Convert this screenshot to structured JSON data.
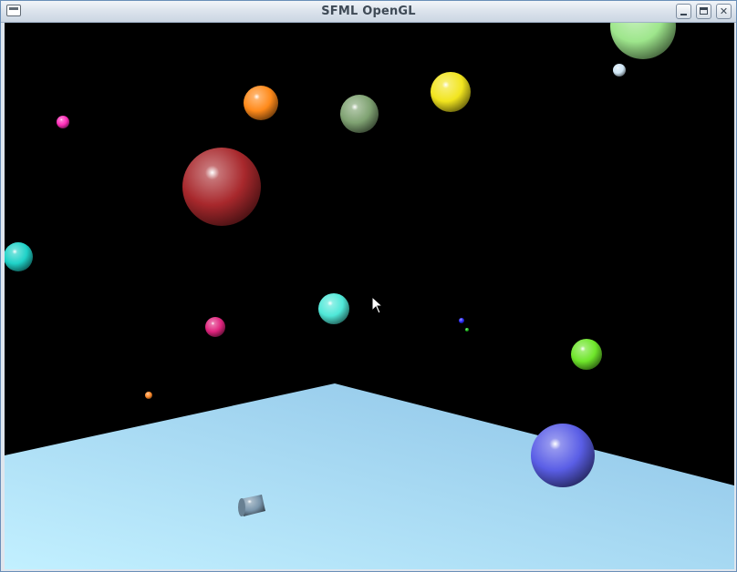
{
  "window": {
    "title": "SFML OpenGL",
    "controls": [
      "minimize",
      "maximize",
      "close"
    ]
  },
  "scene": {
    "background": "#000000",
    "floor": {
      "color_near": "#c2f0ff",
      "color_far": "#8cc2e6"
    },
    "objects": [
      {
        "kind": "sphere",
        "color": "#9ee68c"
      },
      {
        "kind": "sphere",
        "color": "#cfe6f5"
      },
      {
        "kind": "sphere",
        "color": "#ff2db8"
      },
      {
        "kind": "sphere",
        "color": "#ff8a1a"
      },
      {
        "kind": "sphere",
        "color": "#7fa272"
      },
      {
        "kind": "sphere",
        "color": "#f2e51e"
      },
      {
        "kind": "sphere",
        "color": "#a8282c"
      },
      {
        "kind": "sphere",
        "color": "#1fd2c8"
      },
      {
        "kind": "sphere",
        "color": "#4fe8d8"
      },
      {
        "kind": "sphere",
        "color": "#e0247e"
      },
      {
        "kind": "sphere",
        "color": "#2a2aff"
      },
      {
        "kind": "sphere",
        "color": "#20c020"
      },
      {
        "kind": "sphere",
        "color": "#6ee62a"
      },
      {
        "kind": "sphere",
        "color": "#ff8a2a"
      },
      {
        "kind": "sphere",
        "color": "#5a5ee6"
      },
      {
        "kind": "cylinder",
        "color": "#7a96ac"
      }
    ]
  }
}
